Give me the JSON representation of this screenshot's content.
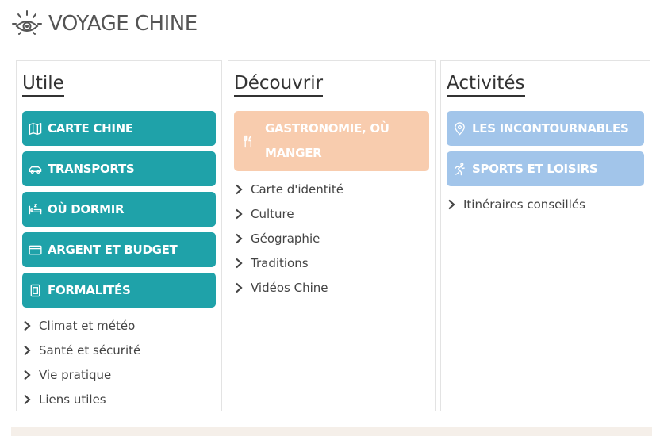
{
  "header": {
    "title": "VOYAGE CHINE",
    "icon": "eye-icon"
  },
  "colors": {
    "teal": "#1fa2a9",
    "peach": "#f8ccae",
    "blue": "#a2c5ea",
    "footer": "#f5efe9"
  },
  "columns": [
    {
      "title": "Utile",
      "buttons": [
        {
          "label": "CARTE CHINE",
          "icon": "map-icon"
        },
        {
          "label": "TRANSPORTS",
          "icon": "car-icon"
        },
        {
          "label": "OÙ DORMIR",
          "icon": "bed-icon"
        },
        {
          "label": "ARGENT ET BUDGET",
          "icon": "credit-card-icon"
        },
        {
          "label": "FORMALITÉS",
          "icon": "passport-icon"
        }
      ],
      "links": [
        "Climat et météo",
        "Santé et sécurité",
        "Vie pratique",
        "Liens utiles"
      ]
    },
    {
      "title": "Découvrir",
      "buttons": [
        {
          "label": "GASTRONOMIE, OÙ MANGER",
          "icon": "cutlery-icon"
        }
      ],
      "links": [
        "Carte d'identité",
        "Culture",
        "Géographie",
        "Traditions",
        "Vidéos Chine"
      ]
    },
    {
      "title": "Activités",
      "buttons": [
        {
          "label": "LES INCONTOURNABLES",
          "icon": "location-pin-icon"
        },
        {
          "label": "SPORTS ET LOISIRS",
          "icon": "runner-icon"
        }
      ],
      "links": [
        "Itinéraires conseillés"
      ]
    }
  ]
}
